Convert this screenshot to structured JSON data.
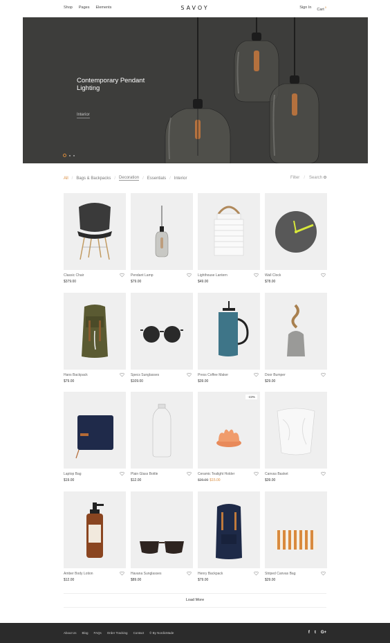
{
  "header": {
    "nav_left": [
      "Shop",
      "Pages",
      "Elements"
    ],
    "logo": "SAVOY",
    "sign_in": "Sign In",
    "cart_label": "Cart",
    "cart_count": "0"
  },
  "hero": {
    "title": "Contemporary Pendant Lighting",
    "subtitle": "Interior",
    "slides": 3,
    "active_slide": 1
  },
  "filters": {
    "categories": [
      "All",
      "Bags & Backpacks",
      "Decoration",
      "Essentials",
      "Interior"
    ],
    "active": "All",
    "filter_label": "Filter",
    "search_label": "Search"
  },
  "products": [
    {
      "name": "Classic Chair",
      "price": "$379.00"
    },
    {
      "name": "Pendant Lamp",
      "price": "$79.00"
    },
    {
      "name": "Lighthouse Lantern",
      "price": "$49.00"
    },
    {
      "name": "Wall Clock",
      "price": "$78.00"
    },
    {
      "name": "Hans Backpack",
      "price": "$79.00"
    },
    {
      "name": "Specs Sunglasses",
      "price": "$109.00"
    },
    {
      "name": "Press Coffee Maker",
      "price": "$39.00"
    },
    {
      "name": "Door Bumper",
      "price": "$29.00"
    },
    {
      "name": "Laptop Bag",
      "price": "$19.00"
    },
    {
      "name": "Plain Glass Bottle",
      "price": "$12.00"
    },
    {
      "name": "Ceramic Tealight Holder",
      "old_price": "$26.00",
      "price": "$15.00",
      "badge": "-43%"
    },
    {
      "name": "Canvas Basket",
      "price": "$39.00"
    },
    {
      "name": "Amber Body Lotion",
      "price": "$12.00"
    },
    {
      "name": "Havana Sunglasses",
      "price": "$89.00"
    },
    {
      "name": "Henry Backpack",
      "price": "$79.00"
    },
    {
      "name": "Striped Canvas Bag",
      "price": "$29.00"
    }
  ],
  "load_more": "Load More",
  "footer": {
    "links": [
      "About Us",
      "Blog",
      "FAQs",
      "Order Tracking",
      "Contact",
      "© By NordicMade"
    ],
    "social": [
      "f",
      "t",
      "G+"
    ]
  },
  "colors": {
    "accent": "#d98c3d",
    "hero_bg": "#3d3d3b",
    "footer_bg": "#2b2b2b",
    "card_bg": "#efefef"
  }
}
